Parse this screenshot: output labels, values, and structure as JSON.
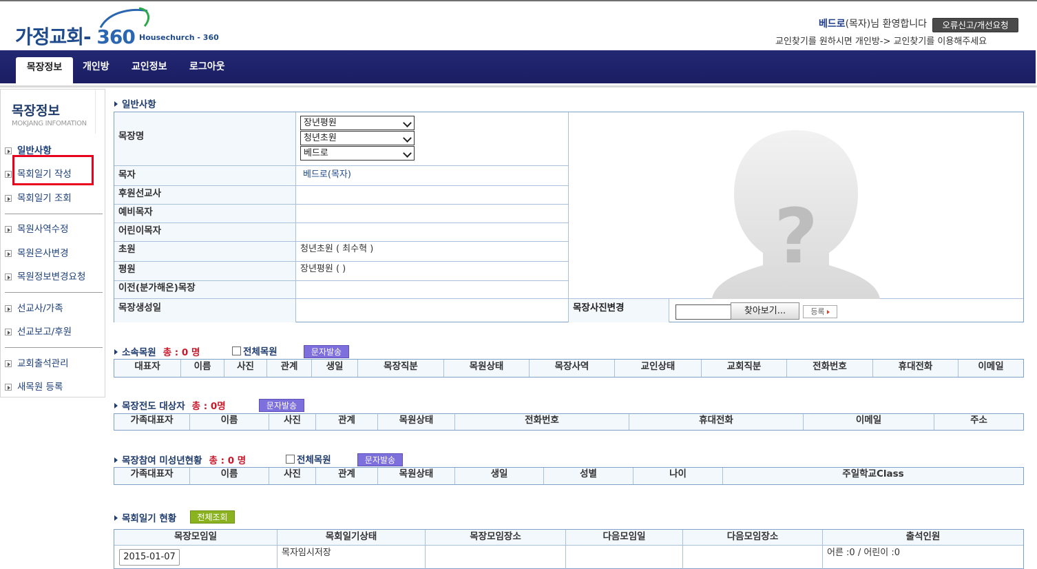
{
  "header": {
    "logo_text": "가정교회",
    "logo_dash": "-",
    "logo_num": "360",
    "logo_sub": "Housechurch - 360",
    "welcome_name": "베드로",
    "welcome_rest": "(목자)님 환영합니다",
    "report_button": "오류신고/개선요청",
    "guide": "교인찾기를 원하시면 개인방-> 교인찾기를 이용해주세요"
  },
  "nav": {
    "items": [
      {
        "label": "목장정보"
      },
      {
        "label": "개인방"
      },
      {
        "label": "교인정보"
      },
      {
        "label": "로그아웃"
      }
    ]
  },
  "sidebar": {
    "title": "목장정보",
    "subtitle": "MOKJANG INFOMATION",
    "items": [
      {
        "label": "일반사항"
      },
      {
        "label": "목회일기 작성"
      },
      {
        "label": "목회일기 조회"
      },
      {
        "label": "목원사역수정"
      },
      {
        "label": "목원은사변경"
      },
      {
        "label": "목원정보변경요청"
      },
      {
        "label": "선교사/가족"
      },
      {
        "label": "선교보고/후원"
      },
      {
        "label": "교회출석관리"
      },
      {
        "label": "새목원 등록"
      }
    ]
  },
  "general": {
    "title": "일반사항",
    "rows": [
      {
        "label": "목장명"
      },
      {
        "label": "목자",
        "value": "베드로(목자)"
      },
      {
        "label": "후원선교사",
        "value": ""
      },
      {
        "label": "예비목자",
        "value": ""
      },
      {
        "label": "어린이목자",
        "value": ""
      },
      {
        "label": "초원",
        "value": "청년초원 ( 최수혁 )"
      },
      {
        "label": "평원",
        "value": "장년평원 ( )"
      },
      {
        "label": "이전(분가해온)목장",
        "value": ""
      },
      {
        "label": "목장생성일",
        "value": ""
      }
    ],
    "selects": [
      "장년평원",
      "청년초원",
      "베드로"
    ],
    "photo_label": "목장사진변경",
    "browse_button": "찾아보기...",
    "register_button": "등록"
  },
  "members": {
    "title": "소속목원",
    "count": "총 : 0 명",
    "check_label": "전체목원",
    "msg_button": "문자발송",
    "columns": [
      "대표자",
      "이름",
      "사진",
      "관계",
      "생일",
      "목장직분",
      "목원상태",
      "목장사역",
      "교인상태",
      "교회직분",
      "전화번호",
      "휴대전화",
      "이메일"
    ]
  },
  "evangelism": {
    "title": "목장전도 대상자",
    "count": "총 : 0명",
    "msg_button": "문자발송",
    "columns": [
      "가족대표자",
      "이름",
      "사진",
      "관계",
      "목원상태",
      "전화번호",
      "휴대전화",
      "이메일",
      "주소"
    ]
  },
  "minors": {
    "title": "목장참여 미성년현황",
    "count": "총 : 0 명",
    "check_label": "전체목원",
    "msg_button": "문자발송",
    "columns": [
      "가족대표자",
      "이름",
      "사진",
      "관계",
      "목원상태",
      "생일",
      "성별",
      "나이",
      "주일학교Class"
    ]
  },
  "diary": {
    "title": "목회일기 현황",
    "all_button": "전체조회",
    "columns": [
      "목장모임일",
      "목회일기상태",
      "목장모임장소",
      "다음모임일",
      "다음모임장소",
      "출석인원"
    ],
    "row": {
      "date": "2015-01-07",
      "status": "목자임시저장",
      "place": "",
      "next_date": "",
      "next_place": "",
      "attendance": "어른 :0 / 어린이 :0"
    }
  }
}
